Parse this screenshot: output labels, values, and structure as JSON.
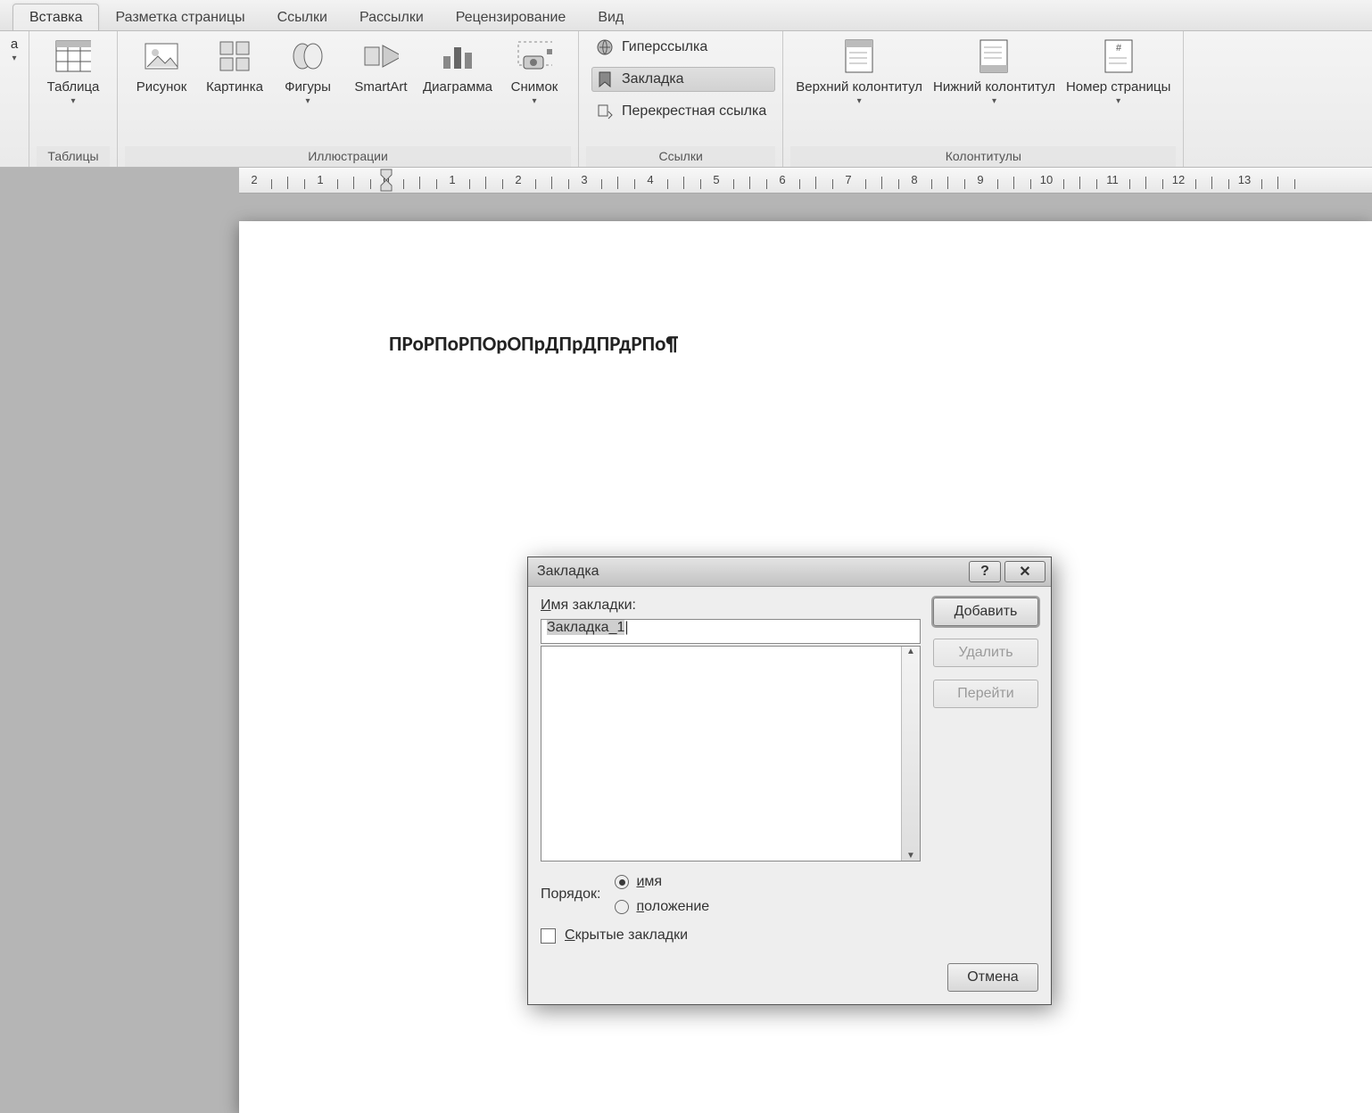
{
  "tabs": {
    "items": [
      "Вставка",
      "Разметка страницы",
      "Ссылки",
      "Рассылки",
      "Рецензирование",
      "Вид"
    ],
    "active_index": 0
  },
  "ribbon": {
    "left_stub": "а",
    "tables": {
      "label": "Таблицы",
      "table_btn": "Таблица"
    },
    "illus": {
      "label": "Иллюстрации",
      "picture": "Рисунок",
      "clipart": "Картинка",
      "shapes": "Фигуры",
      "smartart": "SmartArt",
      "chart": "Диаграмма",
      "screenshot": "Снимок"
    },
    "links": {
      "label": "Ссылки",
      "hyperlink": "Гиперссылка",
      "bookmark": "Закладка",
      "crossref": "Перекрестная ссылка"
    },
    "headfoot": {
      "label": "Колонтитулы",
      "header": "Верхний колонтитул",
      "footer": "Нижний колонтитул",
      "pagenum": "Номер страницы"
    }
  },
  "document": {
    "text": "ПРоРПоРПОрОПрДПрДПРдРПо¶"
  },
  "dialog": {
    "title": "Закладка",
    "name_label": "Имя закладки:",
    "name_value": "Закладка_1",
    "btn_add": "Добавить",
    "btn_delete": "Удалить",
    "btn_goto": "Перейти",
    "order_label": "Порядок:",
    "order_name": "имя",
    "order_location": "положение",
    "hidden": "Скрытые закладки",
    "cancel": "Отмена"
  }
}
